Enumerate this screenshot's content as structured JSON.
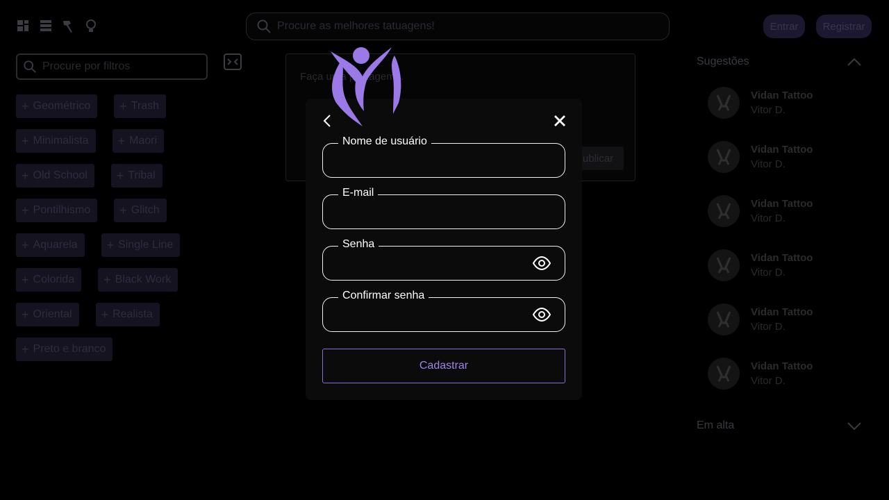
{
  "topbar": {
    "search_placeholder": "Procure as melhores tatuagens!",
    "login_label": "Entrar",
    "register_label": "Registrar"
  },
  "filters": {
    "search_placeholder": "Procure por filtros",
    "tags": [
      [
        "Geométrico",
        "Trash"
      ],
      [
        "Minimalista",
        "Maori"
      ],
      [
        "Old School",
        "Tribal"
      ],
      [
        "Pontilhismo",
        "Glitch"
      ],
      [
        "Aquarela",
        "Single Line"
      ],
      [
        "Colorida",
        "Black Work"
      ],
      [
        "Oriental",
        "Realista"
      ],
      [
        "Preto e branco"
      ]
    ]
  },
  "post": {
    "hint": "Faça uma postagem...",
    "publish_label": "Publicar"
  },
  "sidebar": {
    "suggestions_title": "Sugestões",
    "trending_title": "Em alta",
    "suggestions": [
      {
        "name": "Vidan Tattoo",
        "user": "Vitor D."
      },
      {
        "name": "Vidan Tattoo",
        "user": "Vitor D."
      },
      {
        "name": "Vidan Tattoo",
        "user": "Vitor D."
      },
      {
        "name": "Vidan Tattoo",
        "user": "Vitor D."
      },
      {
        "name": "Vidan Tattoo",
        "user": "Vitor D."
      },
      {
        "name": "Vidan Tattoo",
        "user": "Vitor D."
      }
    ]
  },
  "modal": {
    "fields": {
      "username": "Nome de usuário",
      "email": "E-mail",
      "password": "Senha",
      "confirm_password": "Confirmar senha"
    },
    "submit_label": "Cadastrar",
    "accent": "#9b7ae8"
  }
}
